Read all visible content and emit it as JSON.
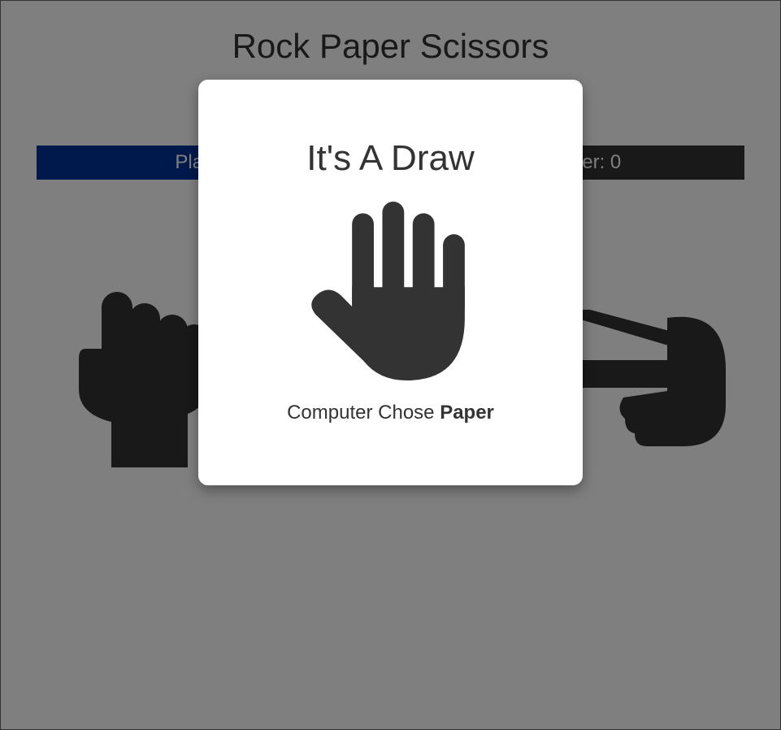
{
  "app": {
    "title": "Rock Paper Scissors"
  },
  "scoreboard": {
    "player_label": "Player: 0",
    "computer_label": "Computer: 0",
    "player_color": "#003399",
    "computer_color": "#333333"
  },
  "choices": [
    {
      "name": "rock",
      "icon": "hand-rock-icon"
    },
    {
      "name": "paper",
      "icon": "hand-paper-icon"
    },
    {
      "name": "scissors",
      "icon": "hand-scissors-icon"
    }
  ],
  "modal": {
    "title": "It's A Draw",
    "icon": "hand-paper-icon",
    "result_prefix": "Computer Chose",
    "result_choice": "Paper"
  }
}
